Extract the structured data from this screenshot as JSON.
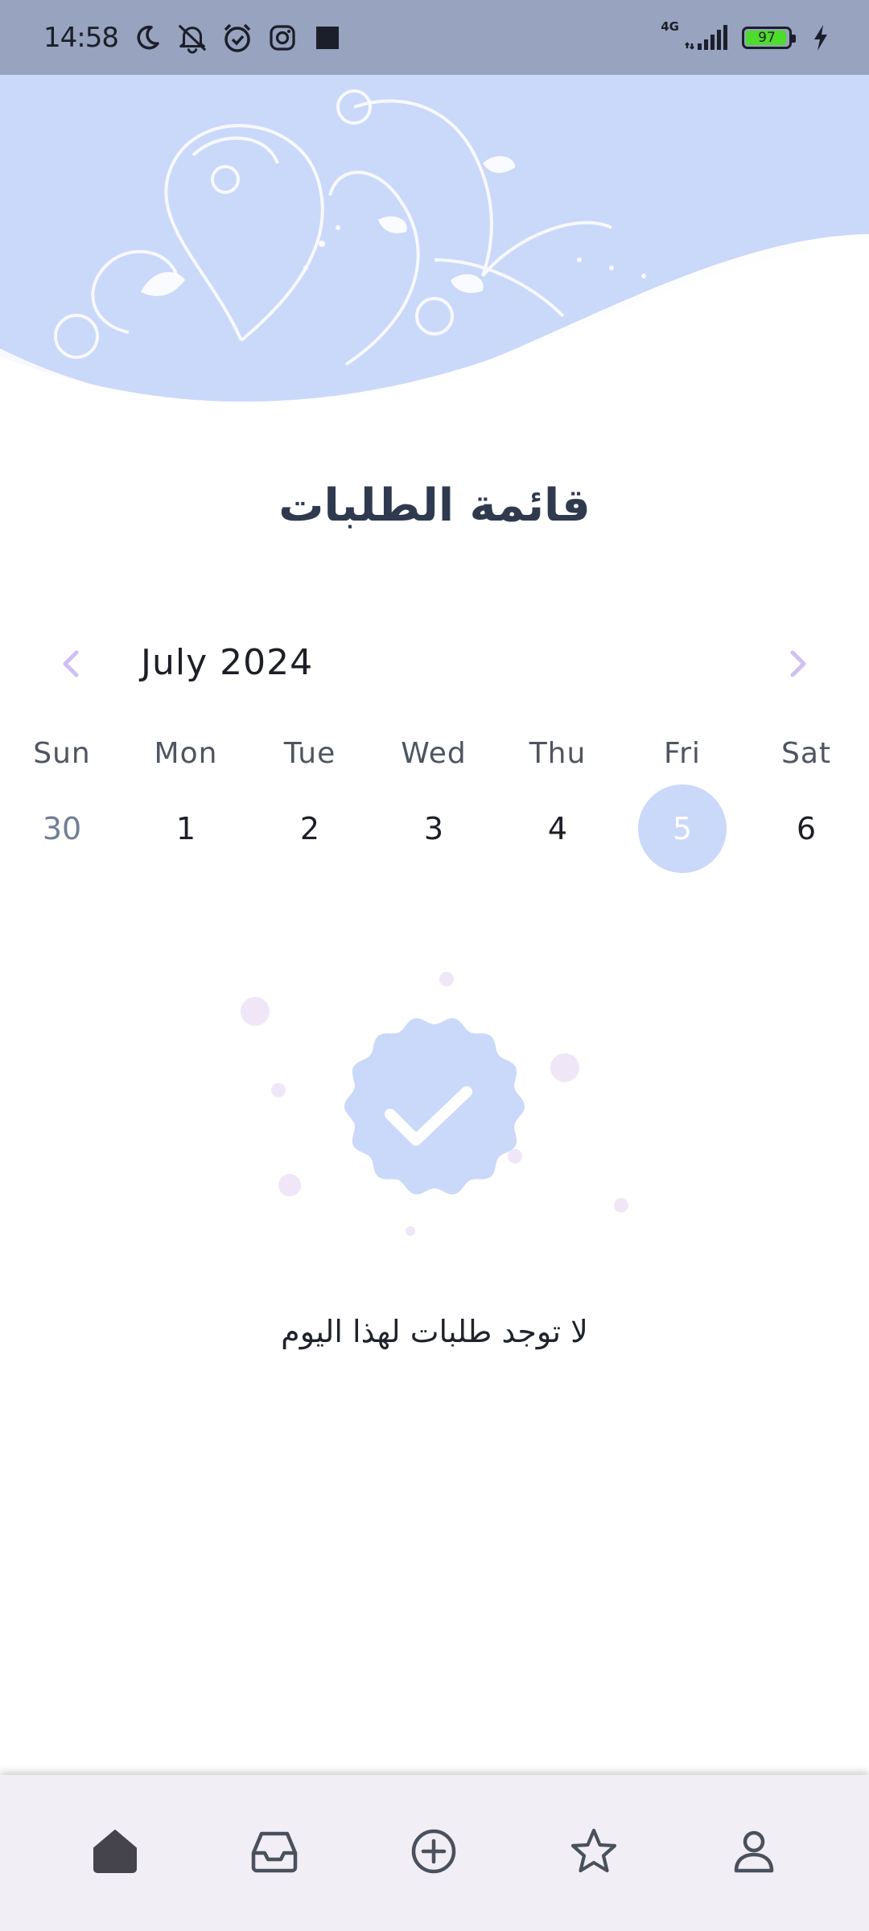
{
  "status_bar": {
    "time": "14:58",
    "network": "4G",
    "battery": "97",
    "icons": [
      "moon-icon",
      "bell-muted-icon",
      "alarm-icon",
      "instagram-icon",
      "square-icon",
      "signal-icon",
      "battery-icon",
      "charging-icon"
    ]
  },
  "header": {
    "title": "قائمة الطلبات"
  },
  "calendar": {
    "month_label": "July 2024",
    "weekdays": [
      "Sun",
      "Mon",
      "Tue",
      "Wed",
      "Thu",
      "Fri",
      "Sat"
    ],
    "dates": [
      "30",
      "1",
      "2",
      "3",
      "4",
      "5",
      "6"
    ],
    "selected_index": 5,
    "muted_index": 0
  },
  "empty_state": {
    "message": "لا توجد طلبات لهذا اليوم",
    "icon": "badge-check-icon"
  },
  "bottom_nav": {
    "items": [
      "home-icon",
      "inbox-icon",
      "add-circle-icon",
      "star-icon",
      "profile-icon"
    ],
    "active_index": 0
  },
  "colors": {
    "status_bar_bg": "#97a3bf",
    "accent_light": "#cad8fa",
    "title": "#2f3a4f",
    "chevron": "#d0bff2",
    "nav_bg": "#f1eef6",
    "battery_fill": "#4ddc2b"
  }
}
